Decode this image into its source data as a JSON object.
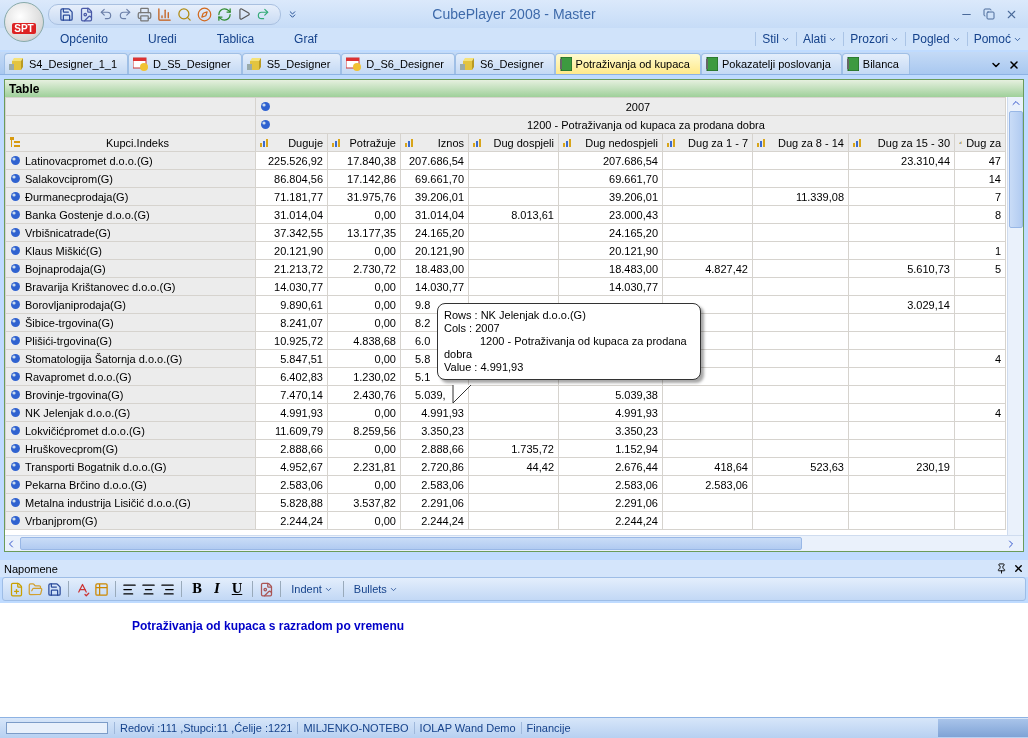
{
  "window": {
    "title": "CubePlayer 2008 - Master",
    "logo_text": "SPT"
  },
  "menus_left": [
    "Općenito",
    "Uredi",
    "Tablica",
    "Graf"
  ],
  "menus_right": [
    "Stil",
    "Alati",
    "Prozori",
    "Pogled",
    "Pomoć"
  ],
  "tabs": [
    {
      "label": "S4_Designer_1_1",
      "kind": "cube",
      "selected": false
    },
    {
      "label": "D_S5_Designer",
      "kind": "dashboard",
      "selected": false
    },
    {
      "label": "S5_Designer",
      "kind": "cube",
      "selected": false
    },
    {
      "label": "D_S6_Designer",
      "kind": "dashboard",
      "selected": false
    },
    {
      "label": "S6_Designer",
      "kind": "cube",
      "selected": false
    },
    {
      "label": "Potraživanja od kupaca",
      "kind": "book",
      "selected": true
    },
    {
      "label": "Pokazatelji poslovanja",
      "kind": "book",
      "selected": false
    },
    {
      "label": "Bilanca",
      "kind": "book",
      "selected": false
    }
  ],
  "table": {
    "title": "Table",
    "column_level_1": "2007",
    "column_level_2": "1200 - Potraživanja od kupaca za prodana dobra",
    "row_dimension": "Kupci.Indeks",
    "columns": [
      "Duguje",
      "Potražuje",
      "Iznos",
      "Dug dospjeli",
      "Dug nedospjeli",
      "Dug za 1 - 7",
      "Dug za 8 - 14",
      "Dug za 15 - 30",
      "Dug za"
    ],
    "rows": [
      {
        "label": "Latinovacpromet d.o.o.(G)",
        "under_tooltip": false,
        "cells": [
          "225.526,92",
          "17.840,38",
          "207.686,54",
          null,
          "207.686,54",
          null,
          null,
          "23.310,44",
          "47"
        ]
      },
      {
        "label": "Salakovciprom(G)",
        "under_tooltip": false,
        "cells": [
          "86.804,56",
          "17.142,86",
          "69.661,70",
          null,
          "69.661,70",
          null,
          null,
          null,
          "14"
        ]
      },
      {
        "label": "Đurmanecprodaja(G)",
        "under_tooltip": false,
        "cells": [
          "71.181,77",
          "31.975,76",
          "39.206,01",
          null,
          "39.206,01",
          null,
          "11.339,08",
          null,
          "7"
        ]
      },
      {
        "label": "Banka Gostenje d.o.o.(G)",
        "under_tooltip": false,
        "cells": [
          "31.014,04",
          "0,00",
          "31.014,04",
          "8.013,61",
          "23.000,43",
          null,
          null,
          null,
          "8"
        ]
      },
      {
        "label": "Vrbišnicatrade(G)",
        "under_tooltip": false,
        "cells": [
          "37.342,55",
          "13.177,35",
          "24.165,20",
          null,
          "24.165,20",
          null,
          null,
          null,
          null
        ]
      },
      {
        "label": "Klaus Miškić(G)",
        "under_tooltip": false,
        "cells": [
          "20.121,90",
          "0,00",
          "20.121,90",
          null,
          "20.121,90",
          null,
          null,
          null,
          "1"
        ]
      },
      {
        "label": "Bojnaprodaja(G)",
        "under_tooltip": false,
        "cells": [
          "21.213,72",
          "2.730,72",
          "18.483,00",
          null,
          "18.483,00",
          "4.827,42",
          null,
          "5.610,73",
          "5"
        ]
      },
      {
        "label": "Bravarija Krištanovec d.o.o.(G)",
        "under_tooltip": false,
        "cells": [
          "14.030,77",
          "0,00",
          "14.030,77",
          null,
          "14.030,77",
          null,
          null,
          null,
          null
        ]
      },
      {
        "label": "Borovljaniprodaja(G)",
        "under_tooltip": true,
        "cells": [
          "9.890,61",
          "0,00",
          "9.8",
          null,
          null,
          null,
          null,
          "3.029,14",
          null
        ]
      },
      {
        "label": "Šibice-trgovina(G)",
        "under_tooltip": true,
        "cells": [
          "8.241,07",
          "0,00",
          "8.2",
          null,
          null,
          null,
          null,
          null,
          null
        ]
      },
      {
        "label": "Plišići-trgovina(G)",
        "under_tooltip": true,
        "cells": [
          "10.925,72",
          "4.838,68",
          "6.0",
          null,
          null,
          null,
          null,
          null,
          null
        ]
      },
      {
        "label": "Stomatologija Šatornja d.o.o.(G)",
        "under_tooltip": true,
        "cells": [
          "5.847,51",
          "0,00",
          "5.8",
          null,
          null,
          null,
          null,
          null,
          "4"
        ]
      },
      {
        "label": "Ravapromet d.o.o.(G)",
        "under_tooltip": true,
        "cells": [
          "6.402,83",
          "1.230,02",
          "5.1",
          null,
          null,
          null,
          null,
          null,
          null
        ]
      },
      {
        "label": "Brovinje-trgovina(G)",
        "under_tooltip": true,
        "cells": [
          "7.470,14",
          "2.430,76",
          "5.039,",
          null,
          "5.039,38",
          null,
          null,
          null,
          null
        ]
      },
      {
        "label": "NK Jelenjak d.o.o.(G)",
        "under_tooltip": false,
        "cells": [
          "4.991,93",
          "0,00",
          "4.991,93",
          null,
          "4.991,93",
          null,
          null,
          null,
          "4"
        ]
      },
      {
        "label": "Lokvičićpromet d.o.o.(G)",
        "under_tooltip": false,
        "cells": [
          "11.609,79",
          "8.259,56",
          "3.350,23",
          null,
          "3.350,23",
          null,
          null,
          null,
          null
        ]
      },
      {
        "label": "Hruškovecprom(G)",
        "under_tooltip": false,
        "cells": [
          "2.888,66",
          "0,00",
          "2.888,66",
          "1.735,72",
          "1.152,94",
          null,
          null,
          null,
          null
        ]
      },
      {
        "label": "Transporti Bogatnik d.o.o.(G)",
        "under_tooltip": false,
        "cells": [
          "4.952,67",
          "2.231,81",
          "2.720,86",
          "44,42",
          "2.676,44",
          "418,64",
          "523,63",
          "230,19",
          null
        ]
      },
      {
        "label": "Pekarna Brčino d.o.o.(G)",
        "under_tooltip": false,
        "cells": [
          "2.583,06",
          "0,00",
          "2.583,06",
          null,
          "2.583,06",
          "2.583,06",
          null,
          null,
          null
        ]
      },
      {
        "label": "Metalna industrija Lisičić d.o.o.(G)",
        "under_tooltip": false,
        "cells": [
          "5.828,88",
          "3.537,82",
          "2.291,06",
          null,
          "2.291,06",
          null,
          null,
          null,
          null
        ]
      },
      {
        "label": "Vrbanjprom(G)",
        "under_tooltip": false,
        "cells": [
          "2.244,24",
          "0,00",
          "2.244,24",
          null,
          "2.244,24",
          null,
          null,
          null,
          null
        ]
      }
    ]
  },
  "tooltip": {
    "rows": "Rows : NK Jelenjak d.o.o.(G)",
    "cols": "Cols : 2007",
    "member": "1200 - Potraživanja od kupaca za prodana dobra",
    "value": "Value : 4.991,93"
  },
  "notes": {
    "title": "Napomene",
    "format_buttons": [
      "B",
      "I",
      "U"
    ],
    "dropdowns": [
      "Indent",
      "Bullets"
    ],
    "text": "Potraživanja od kupaca s razradom po vremenu"
  },
  "status_bar": {
    "items": [
      "Redovi :111 ,Stupci:11 ,Ćelije :1221",
      "MILJENKO-NOTEBO",
      "IOLAP Wand Demo",
      "Financije"
    ]
  }
}
